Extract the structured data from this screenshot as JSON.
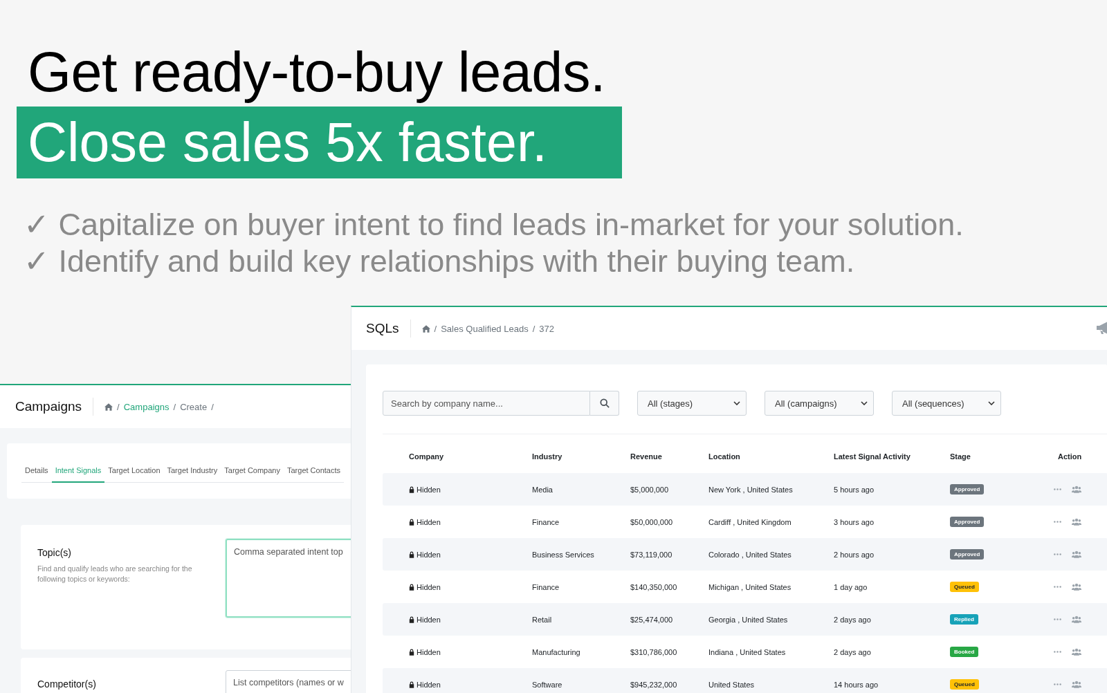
{
  "hero": {
    "headline": "Get ready-to-buy leads.",
    "highlight": "Close sales 5x faster.",
    "bullets": [
      "✓ Capitalize on buyer intent to find leads in-market for your solution.",
      "✓ Identify and build key relationships with their buying team."
    ]
  },
  "campaigns_window": {
    "title": "Campaigns",
    "separator": "/",
    "breadcrumb": [
      {
        "label": "Campaigns",
        "link": true
      },
      {
        "label": "Create",
        "link": false
      }
    ],
    "tabs": [
      {
        "label": "Details",
        "selected": false
      },
      {
        "label": "Intent Signals",
        "selected": true
      },
      {
        "label": "Target Location",
        "selected": false
      },
      {
        "label": "Target Industry",
        "selected": false
      },
      {
        "label": "Target Company",
        "selected": false
      },
      {
        "label": "Target Contacts",
        "selected": false
      }
    ],
    "fields": [
      {
        "label": "Topic(s)",
        "help": "Find and qualify leads who are searching for the following topics or keywords:",
        "placeholder": "Comma separated intent top",
        "focused": true
      },
      {
        "label": "Competitor(s)",
        "placeholder": "List competitors (names or w",
        "focused": false
      }
    ]
  },
  "sqls_window": {
    "title": "SQLs",
    "separator": "/",
    "breadcrumb": [
      "Sales Qualified Leads",
      "372"
    ],
    "search": {
      "placeholder": "Search by company name..."
    },
    "filters": [
      "All (stages)",
      "All (campaigns)",
      "All (sequences)"
    ],
    "table": {
      "columns": [
        "Company",
        "Industry",
        "Revenue",
        "Location",
        "Latest Signal Activity",
        "Stage",
        "Action"
      ],
      "rows": [
        {
          "company": "Hidden",
          "industry": "Media",
          "revenue": "$5,000,000",
          "location": "New York , United States",
          "activity": "5 hours ago",
          "stage": "Approved",
          "color": "#6c757d"
        },
        {
          "company": "Hidden",
          "industry": "Finance",
          "revenue": "$50,000,000",
          "location": "Cardiff , United Kingdom",
          "activity": "3 hours ago",
          "stage": "Approved",
          "color": "#6c757d"
        },
        {
          "company": "Hidden",
          "industry": "Business Services",
          "revenue": "$73,119,000",
          "location": "Colorado , United States",
          "activity": "2 hours ago",
          "stage": "Approved",
          "color": "#6c757d"
        },
        {
          "company": "Hidden",
          "industry": "Finance",
          "revenue": "$140,350,000",
          "location": "Michigan , United States",
          "activity": "1 day ago",
          "stage": "Queued",
          "color": "#ffc107"
        },
        {
          "company": "Hidden",
          "industry": "Retail",
          "revenue": "$25,474,000",
          "location": "Georgia , United States",
          "activity": "2 days ago",
          "stage": "Replied",
          "color": "#17a2b8"
        },
        {
          "company": "Hidden",
          "industry": "Manufacturing",
          "revenue": "$310,786,000",
          "location": "Indiana , United States",
          "activity": "2 days ago",
          "stage": "Booked",
          "color": "#28a745"
        },
        {
          "company": "Hidden",
          "industry": "Software",
          "revenue": "$945,232,000",
          "location": "United States",
          "activity": "14 hours ago",
          "stage": "Queued",
          "color": "#ffc107"
        }
      ]
    }
  }
}
